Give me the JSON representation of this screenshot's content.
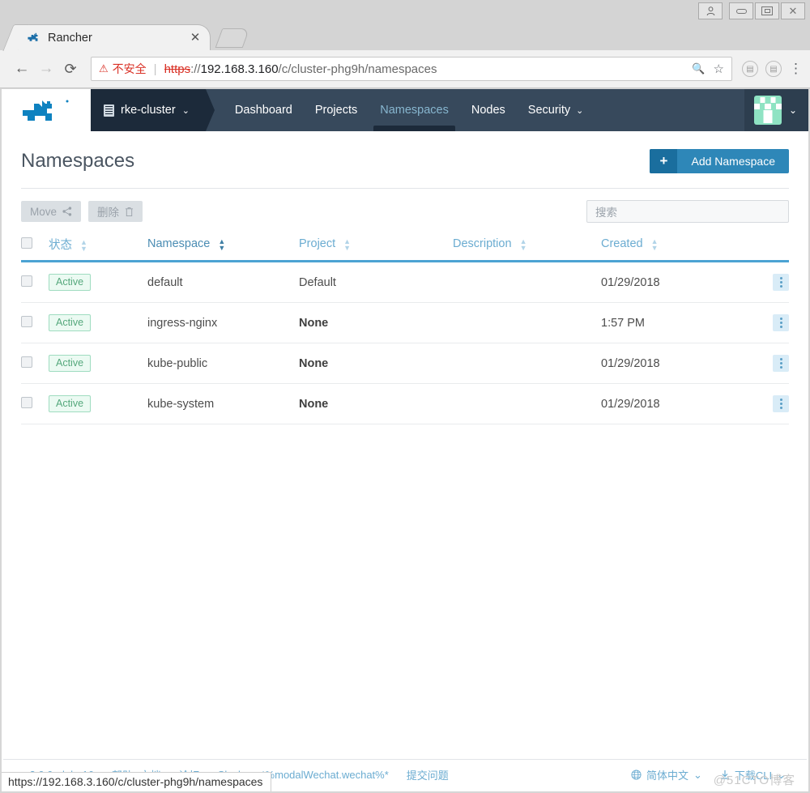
{
  "browser": {
    "window_controls": {
      "user_icon": "person-icon",
      "minimize": "—",
      "maximize": "❐",
      "close": "✕"
    },
    "tab": {
      "title": "Rancher",
      "close": "✕",
      "favicon": "rancher-cow-icon"
    },
    "nav": {
      "back": "←",
      "forward": "→",
      "reload": "⟳"
    },
    "omnibox": {
      "security_warning": "不安全",
      "warning_icon": "⚠",
      "separator": "|",
      "scheme": "https",
      "scheme_rest": "://",
      "host": "192.168.3.160",
      "path": "/c/cluster-phg9h/namespaces",
      "zoom_icon": "🔍",
      "bookmark_icon": "☆"
    },
    "extensions": [
      "extension-icon-1",
      "extension-icon-2"
    ],
    "menu_icon": "⋮",
    "status_url": "https://192.168.3.160/c/cluster-phg9h/namespaces"
  },
  "navbar": {
    "logo": "rancher-logo",
    "cluster": {
      "label": "rke-cluster",
      "icon": "cluster-icon",
      "caret": "⌄"
    },
    "links": [
      {
        "label": "Dashboard",
        "active": false,
        "caret": ""
      },
      {
        "label": "Projects",
        "active": false,
        "caret": ""
      },
      {
        "label": "Namespaces",
        "active": true,
        "caret": ""
      },
      {
        "label": "Nodes",
        "active": false,
        "caret": ""
      },
      {
        "label": "Security",
        "active": false,
        "caret": "⌄"
      }
    ],
    "user": {
      "avatar": "user-avatar",
      "caret": "⌄"
    }
  },
  "page": {
    "title": "Namespaces",
    "add_button": {
      "icon": "+",
      "label": "Add Namespace"
    },
    "toolbar": {
      "move": {
        "label": "Move",
        "icon": "share-icon"
      },
      "delete": {
        "label": "删除",
        "icon": "trash-icon"
      }
    },
    "search": {
      "placeholder": "搜索",
      "value": ""
    }
  },
  "table": {
    "columns": [
      {
        "key": "check",
        "label": "",
        "sortable": false,
        "sorted": false
      },
      {
        "key": "state",
        "label": "状态",
        "sortable": true,
        "sorted": false
      },
      {
        "key": "name",
        "label": "Namespace",
        "sortable": true,
        "sorted": true
      },
      {
        "key": "project",
        "label": "Project",
        "sortable": true,
        "sorted": false
      },
      {
        "key": "desc",
        "label": "Description",
        "sortable": true,
        "sorted": false
      },
      {
        "key": "created",
        "label": "Created",
        "sortable": true,
        "sorted": false
      },
      {
        "key": "actions",
        "label": "",
        "sortable": false,
        "sorted": false
      }
    ],
    "rows": [
      {
        "state": "Active",
        "name": "default",
        "project": "Default",
        "project_bold": false,
        "desc": "",
        "created": "01/29/2018"
      },
      {
        "state": "Active",
        "name": "ingress-nginx",
        "project": "None",
        "project_bold": true,
        "desc": "",
        "created": "1:57 PM"
      },
      {
        "state": "Active",
        "name": "kube-public",
        "project": "None",
        "project_bold": true,
        "desc": "",
        "created": "01/29/2018"
      },
      {
        "state": "Active",
        "name": "kube-system",
        "project": "None",
        "project_bold": true,
        "desc": "",
        "created": "01/29/2018"
      }
    ]
  },
  "footer": {
    "links": [
      "v2.0.0-alpha16",
      "帮助&文档",
      "论坛",
      "Slack",
      "*%modalWechat.wechat%*",
      "提交问题"
    ],
    "language": {
      "icon": "globe-icon",
      "label": "简体中文",
      "caret": "⌄"
    },
    "cli": {
      "icon": "download-icon",
      "label": "下载CLI",
      "caret": "⌄"
    },
    "watermark": "@51CTO博客"
  },
  "colors": {
    "navbar": "#37495c",
    "cluster_picker": "#1c2a3a",
    "accent_blue": "#2e87b8",
    "link_blue": "#6bacd1",
    "active_green": "#55a87c",
    "header_underline": "#4ba3d3"
  }
}
